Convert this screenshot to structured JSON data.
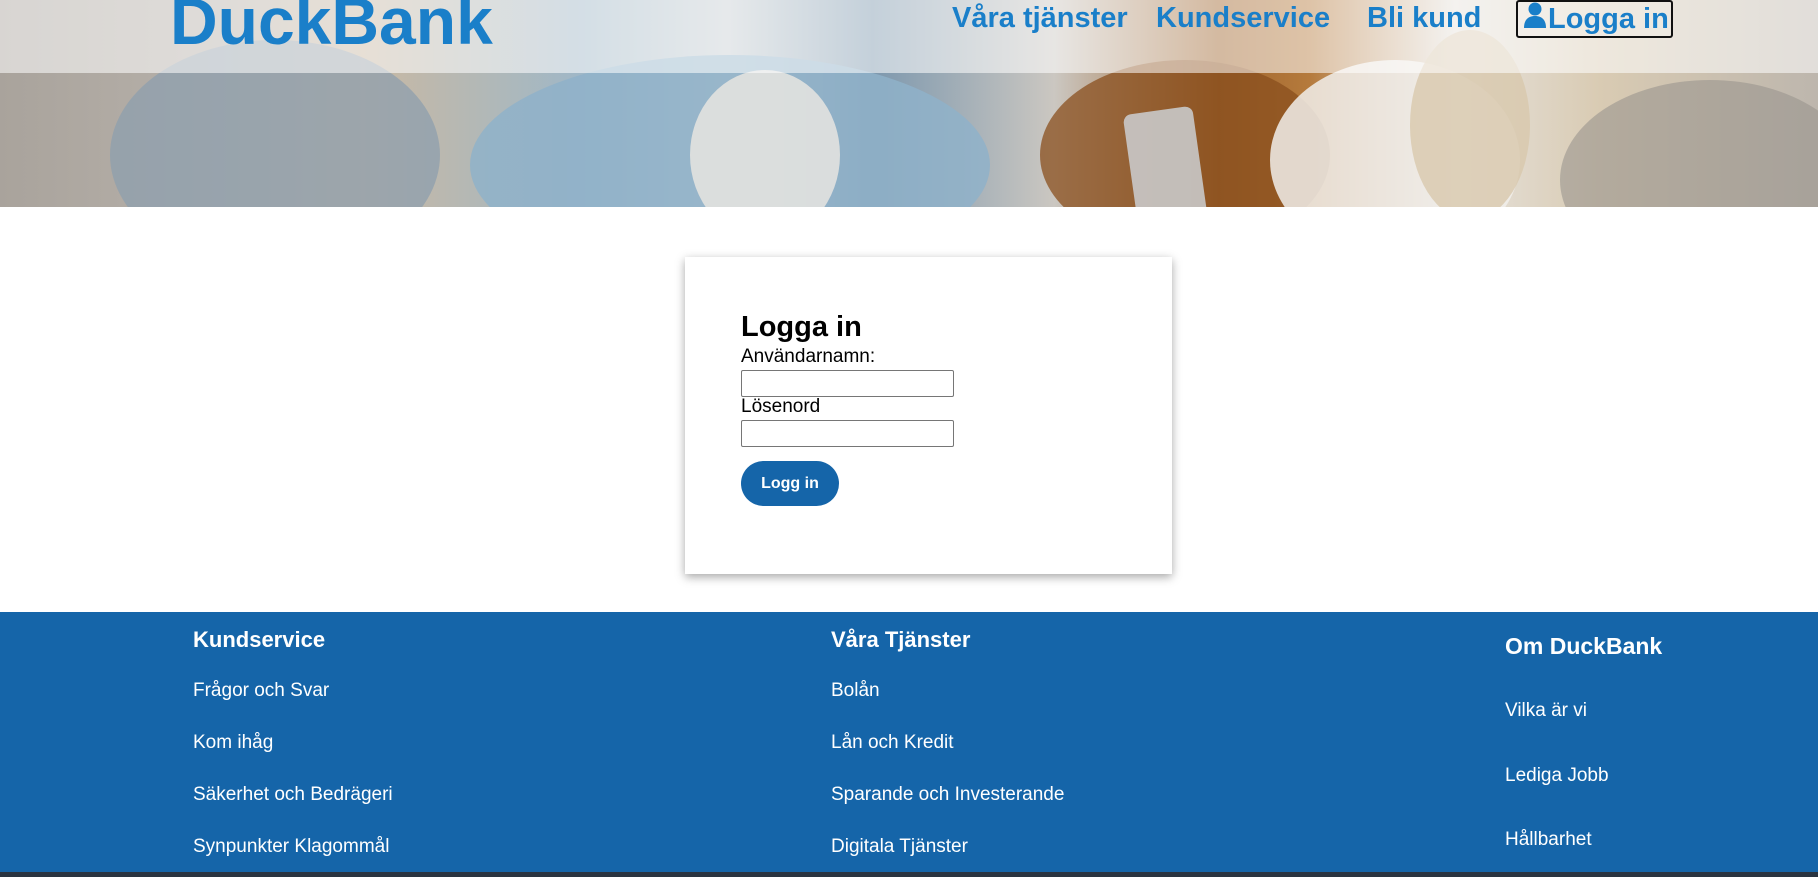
{
  "header": {
    "brand": "DuckBank",
    "nav": [
      {
        "label": "Våra tjänster"
      },
      {
        "label": "Kundservice"
      },
      {
        "label": "Bli kund"
      }
    ],
    "login_label": "Logga in",
    "login_icon": "user-icon"
  },
  "login": {
    "title": "Logga in",
    "username_label": "Användarnamn:",
    "username_value": "",
    "password_label": "Lösenord",
    "password_value": "",
    "submit_label": "Logg in"
  },
  "footer": {
    "columns": [
      {
        "heading": "Kundservice",
        "links": [
          "Frågor och Svar",
          "Kom ihåg",
          "Säkerhet och Bedrägeri",
          "Synpunkter Klagommål"
        ]
      },
      {
        "heading": "Våra Tjänster",
        "links": [
          "Bolån",
          "Lån och Kredit",
          "Sparande och Investerande",
          "Digitala Tjänster"
        ]
      },
      {
        "heading": "Om DuckBank",
        "links": [
          "Vilka är vi",
          "Lediga Jobb",
          "Hållbarhet"
        ]
      }
    ]
  },
  "colors": {
    "brand_blue": "#1a7fc9",
    "footer_blue": "#1565a9",
    "button_blue": "#1565a9"
  }
}
